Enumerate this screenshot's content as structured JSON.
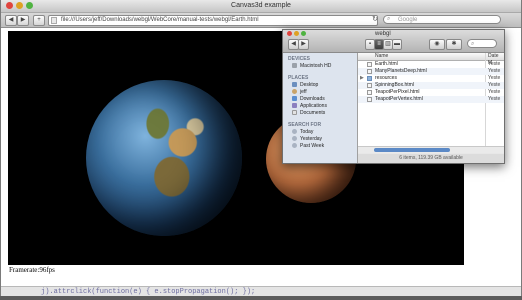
{
  "browser": {
    "title": "Canvas3d example",
    "url": "file:///Users/jeff/Downloads/webgl/WebCore/manual-tests/webgl/Earth.html",
    "search_placeholder": "Google",
    "back_label": "◀",
    "forward_label": "▶",
    "add_label": "+",
    "reload_label": "↻",
    "colors": {
      "close": "#e0443e",
      "minimize": "#dea123",
      "zoom": "#4fb341"
    }
  },
  "page": {
    "fps_text": "Framerate:96fps",
    "code_line": "j).attrclick(function(e) { e.stopPropagation(); });"
  },
  "finder": {
    "folder": "webgl",
    "sidebar": {
      "devices_header": "DEVICES",
      "devices": [
        "Macintosh HD"
      ],
      "places_header": "PLACES",
      "places": [
        "Desktop",
        "jeff",
        "Downloads",
        "Applications",
        "Documents"
      ],
      "search_header": "SEARCH FOR",
      "searches": [
        "Today",
        "Yesterday",
        "Past Week"
      ]
    },
    "columns": {
      "name": "Name",
      "date": "Date M"
    },
    "files": [
      {
        "name": "Earth.html",
        "date": "Yeste"
      },
      {
        "name": "ManyPlanetsDeep.html",
        "date": "Yeste"
      },
      {
        "name": "resources",
        "date": "Yeste"
      },
      {
        "name": "SpinningBox.html",
        "date": "Yeste"
      },
      {
        "name": "TeapotPerPixel.html",
        "date": "Yeste"
      },
      {
        "name": "TeapotPerVertex.html",
        "date": "Yeste"
      }
    ],
    "status": "6 items, 119.39 GB available"
  }
}
